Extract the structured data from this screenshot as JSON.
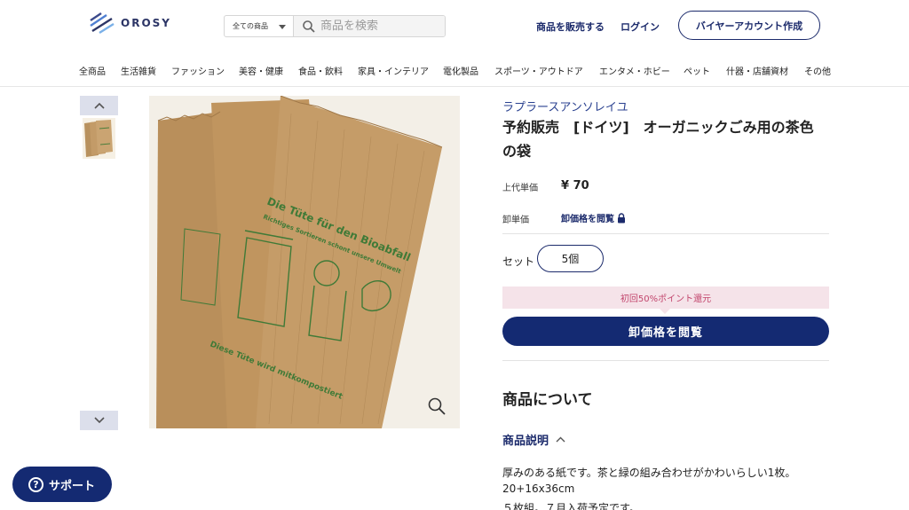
{
  "header": {
    "logo_text": "OROSY",
    "search": {
      "category": "全ての商品",
      "placeholder": "商品を検索"
    },
    "sell_link": "商品を販売する",
    "login_link": "ログイン",
    "buyer_button": "バイヤーアカウント作成"
  },
  "categories": [
    "全商品",
    "生活雑貨",
    "ファッション",
    "美容・健康",
    "食品・飲料",
    "家具・インテリア",
    "電化製品",
    "スポーツ・アウトドア",
    "エンタメ・ホビー",
    "ペット",
    "什器・店舗資材",
    "その他"
  ],
  "product": {
    "brand": "ラプラースアンソレイユ",
    "title_line1": "予約販売　[ドイツ]　オーガニックごみ用の茶色",
    "title_line2": "の袋",
    "retail_label": "上代単価",
    "retail_price": "¥ 70",
    "wholesale_label": "卸単価",
    "wholesale_link": "卸価格を閲覧",
    "set_label": "セット",
    "set_value": "5個",
    "promo": "初回50%ポイント還元",
    "cta": "卸価格を閲覧",
    "image_text": {
      "headline": "Die Tüte für den Bioabfall",
      "sub": "Richtiges Sortieren schont unsere Umwelt",
      "bottom": "Diese Tüte wird mitkompostiert"
    }
  },
  "about": {
    "heading": "商品について",
    "desc_title": "商品説明",
    "lines": [
      "厚みのある紙です。茶と緑の組み合わせがかわいらしい1枚。",
      "20+16x36cm",
      "５枚組。７月入荷予定です。"
    ]
  },
  "support_button": "サポート",
  "colors": {
    "navy": "#142a72",
    "link": "#2b4290",
    "promo_bg": "#f5e3e9",
    "promo_text": "#c2466d"
  }
}
